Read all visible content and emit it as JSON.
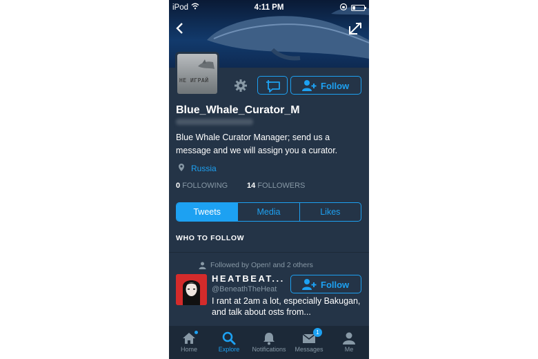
{
  "status_bar": {
    "carrier": "iPod",
    "time": "4:11 PM"
  },
  "profile": {
    "avatar_text": "НЕ ИГРАЙ",
    "name": "Blue_Whale_Curator_M",
    "bio": "Blue Whale Curator Manager; send us a message and we will assign you a curator.",
    "location": "Russia",
    "following_count": "0",
    "following_label": "FOLLOWING",
    "followers_count": "14",
    "followers_label": "FOLLOWERS",
    "follow_label": "Follow"
  },
  "tabs": [
    "Tweets",
    "Media",
    "Likes"
  ],
  "who_to_follow": {
    "title": "WHO TO FOLLOW",
    "followed_by": "Followed by Open! and 2 others",
    "user_name": "HEATBEAT...",
    "user_handle": "@BeneathTheHeat",
    "user_bio": "I rant at 2am a lot, especially Bakugan, and talk about osts from...",
    "follow_label": "Follow"
  },
  "tab_bar": [
    {
      "label": "Home",
      "icon": "home-icon"
    },
    {
      "label": "Explore",
      "icon": "search-icon"
    },
    {
      "label": "Notifications",
      "icon": "bell-icon"
    },
    {
      "label": "Messages",
      "icon": "envelope-icon",
      "badge": "1"
    },
    {
      "label": "Me",
      "icon": "person-icon"
    }
  ],
  "colors": {
    "accent": "#1da1f2",
    "background": "#243447",
    "tabbar": "#1c2938",
    "muted": "#8899a6"
  }
}
